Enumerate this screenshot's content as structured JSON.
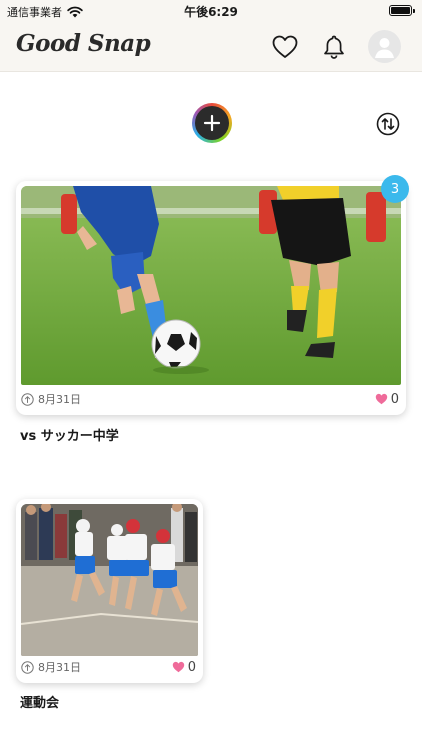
{
  "status_bar": {
    "carrier": "通信事業者",
    "time": "午後6:29",
    "wifi_icon": "wifi-icon",
    "battery_icon": "battery-full-icon"
  },
  "nav": {
    "logo": "Good Snap",
    "icons": [
      "heart-outline-icon",
      "bell-icon",
      "user-avatar-icon"
    ]
  },
  "toolbar": {
    "add_icon": "plus-icon",
    "sort_icon": "sort-arrows-icon"
  },
  "albums": [
    {
      "title": "vs サッカー中学",
      "date": "8月31日",
      "likes": "0",
      "badge": "3",
      "photo": "soccer-players-photo"
    },
    {
      "title": "運動会",
      "date": "8月31日",
      "likes": "0",
      "photo": "sports-day-race-photo"
    }
  ],
  "colors": {
    "header_bg": "#f8f6f2",
    "badge": "#3bb9ec",
    "like_heart": "#ef6b9a",
    "add_button": "#2b2b2b"
  }
}
